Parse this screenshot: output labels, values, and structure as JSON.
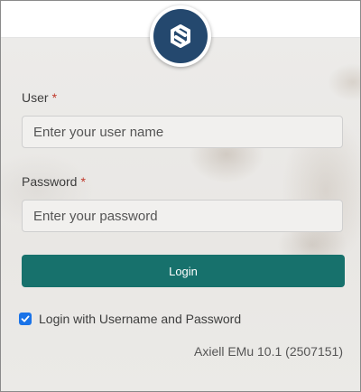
{
  "logo": {
    "icon": "emu-aperture-logo-icon",
    "color": "#24486e"
  },
  "form": {
    "user_label": "User",
    "user_required": "*",
    "user_placeholder": "Enter your user name",
    "password_label": "Password",
    "password_required": "*",
    "password_placeholder": "Enter your password",
    "login_label": "Login",
    "login_color": "#17716c",
    "remember_label": "Login with Username and Password",
    "remember_checked": true
  },
  "footer": {
    "version": "Axiell EMu 10.1 (2507151)"
  }
}
